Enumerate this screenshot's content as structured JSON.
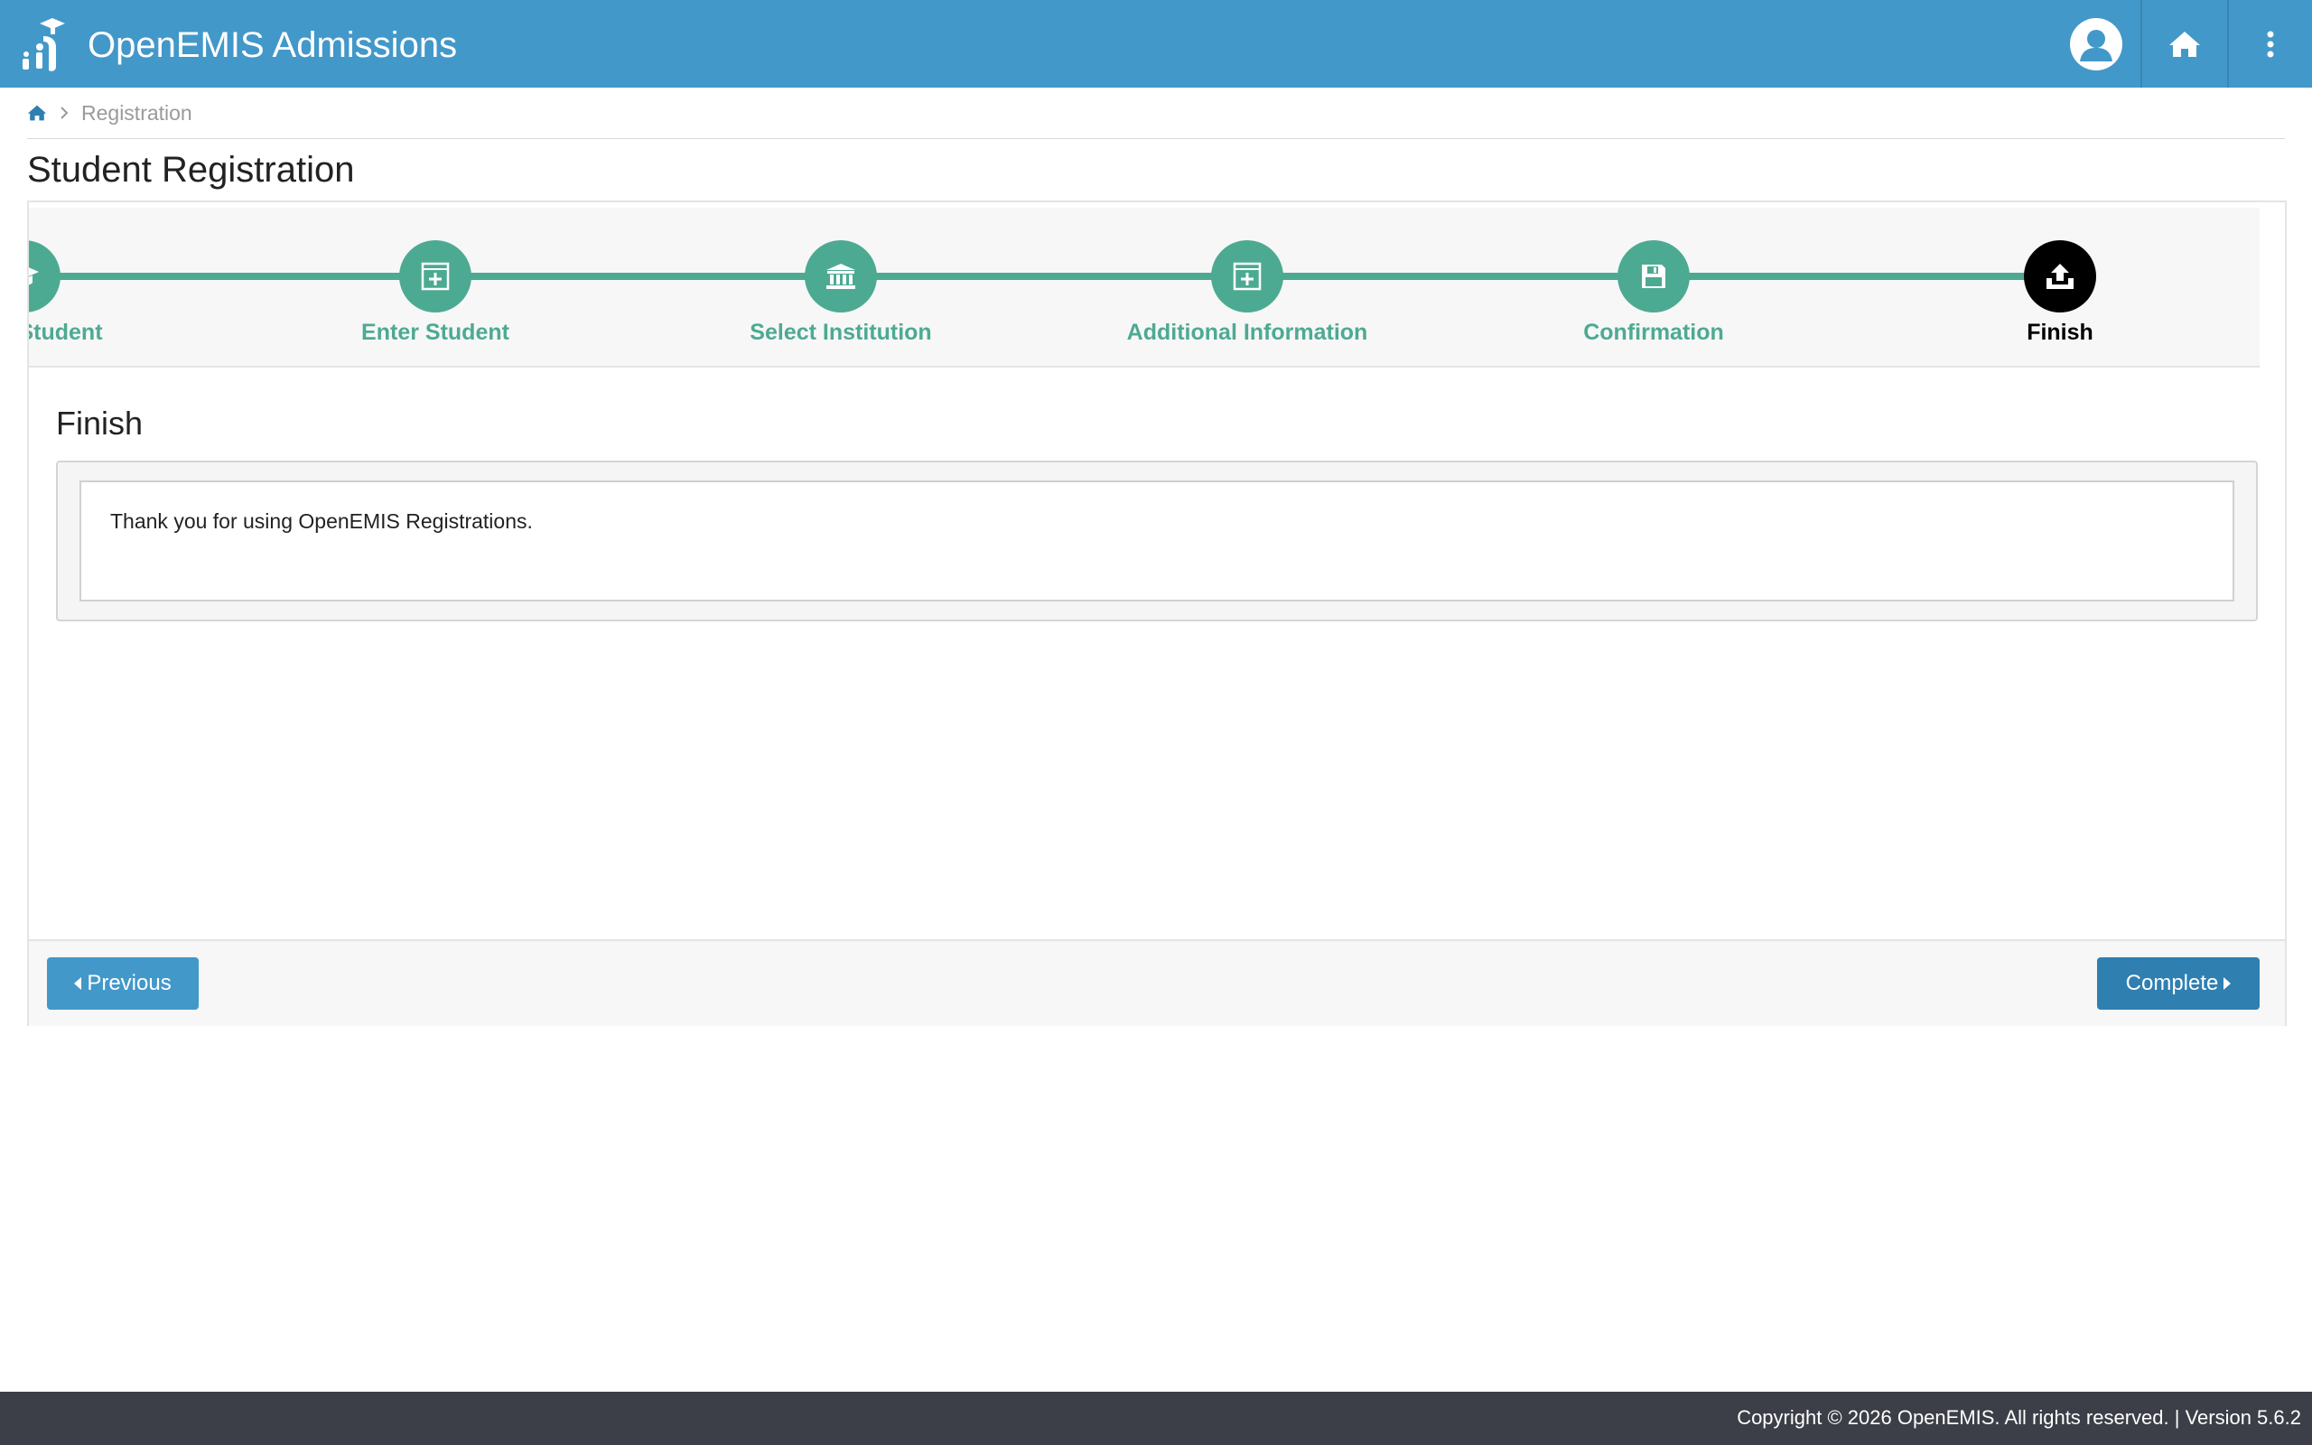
{
  "header": {
    "title": "OpenEMIS Admissions",
    "icons": [
      "openemis-logo",
      "user-avatar-icon",
      "home-icon",
      "more-vert-icon"
    ]
  },
  "breadcrumb": {
    "current": "Registration"
  },
  "page": {
    "title": "Student Registration"
  },
  "wizard": {
    "steps": [
      {
        "label": "Student",
        "icon": "graduation-cap-icon",
        "state": "completed"
      },
      {
        "label": "Enter Student",
        "icon": "plus-square-icon",
        "state": "completed"
      },
      {
        "label": "Select Institution",
        "icon": "institution-icon",
        "state": "completed"
      },
      {
        "label": "Additional Information",
        "icon": "plus-square-icon",
        "state": "completed"
      },
      {
        "label": "Confirmation",
        "icon": "save-icon",
        "state": "completed"
      },
      {
        "label": "Finish",
        "icon": "upload-icon",
        "state": "active"
      }
    ]
  },
  "section": {
    "title": "Finish",
    "message": "Thank you for using OpenEMIS Registrations."
  },
  "buttons": {
    "previous": "Previous",
    "complete": "Complete"
  },
  "footer": {
    "text": "Copyright © 2026 OpenEMIS. All rights reserved. | Version 5.6.2"
  },
  "colors": {
    "header": "#4298c9",
    "step_done": "#4daa92",
    "step_active": "#000000",
    "footer": "#3c3f47"
  }
}
